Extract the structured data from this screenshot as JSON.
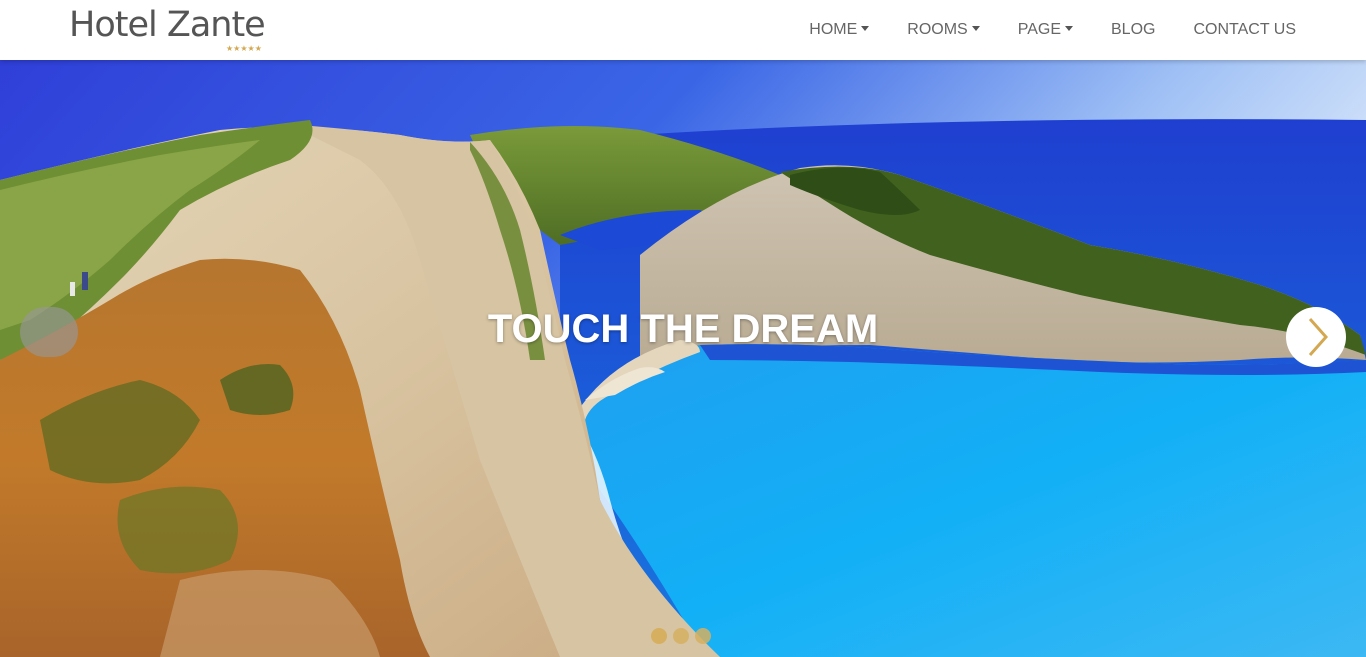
{
  "brand": {
    "name": "Hotel Zante",
    "stars": "★★★★★",
    "star_color": "#d4a850"
  },
  "nav": {
    "items": [
      {
        "label": "HOME",
        "dropdown": true
      },
      {
        "label": "ROOMS",
        "dropdown": true
      },
      {
        "label": "PAGE",
        "dropdown": true
      },
      {
        "label": "BLOG",
        "dropdown": false
      },
      {
        "label": "CONTACT US",
        "dropdown": false
      }
    ]
  },
  "hero": {
    "caption": "TOUCH THE DREAM",
    "image": "navagio-shipwreck-beach-photo",
    "prev_icon": "chevron-left-icon",
    "next_icon": "chevron-right-icon",
    "accent_color": "#d4a850",
    "slides": 3,
    "active_slide": 1
  }
}
